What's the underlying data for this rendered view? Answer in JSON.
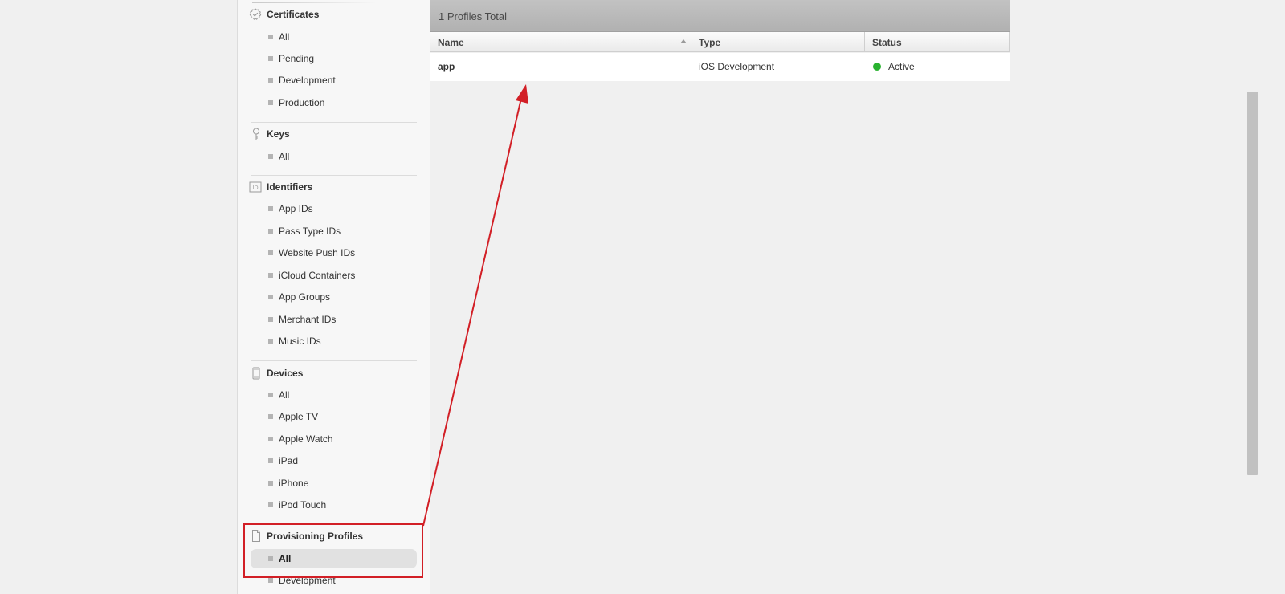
{
  "sidebar": {
    "certificates": {
      "title": "Certificates",
      "icon": "certificate-icon",
      "items": [
        "All",
        "Pending",
        "Development",
        "Production"
      ]
    },
    "keys": {
      "title": "Keys",
      "icon": "key-icon",
      "items": [
        "All"
      ]
    },
    "identifiers": {
      "title": "Identifiers",
      "icon": "id-icon",
      "items": [
        "App IDs",
        "Pass Type IDs",
        "Website Push IDs",
        "iCloud Containers",
        "App Groups",
        "Merchant IDs",
        "Music IDs"
      ]
    },
    "devices": {
      "title": "Devices",
      "icon": "device-icon",
      "items": [
        "All",
        "Apple TV",
        "Apple Watch",
        "iPad",
        "iPhone",
        "iPod Touch"
      ]
    },
    "provisioning": {
      "title": "Provisioning Profiles",
      "icon": "document-icon",
      "items": [
        "All",
        "Development"
      ],
      "selected": "All"
    }
  },
  "main": {
    "total_text": "1 Profiles Total",
    "columns": {
      "name": "Name",
      "type": "Type",
      "status": "Status"
    },
    "rows": [
      {
        "name": "app",
        "type": "iOS Development",
        "status": "Active"
      }
    ]
  },
  "colors": {
    "active_status": "#29b22f",
    "annotation": "#d21f26"
  }
}
